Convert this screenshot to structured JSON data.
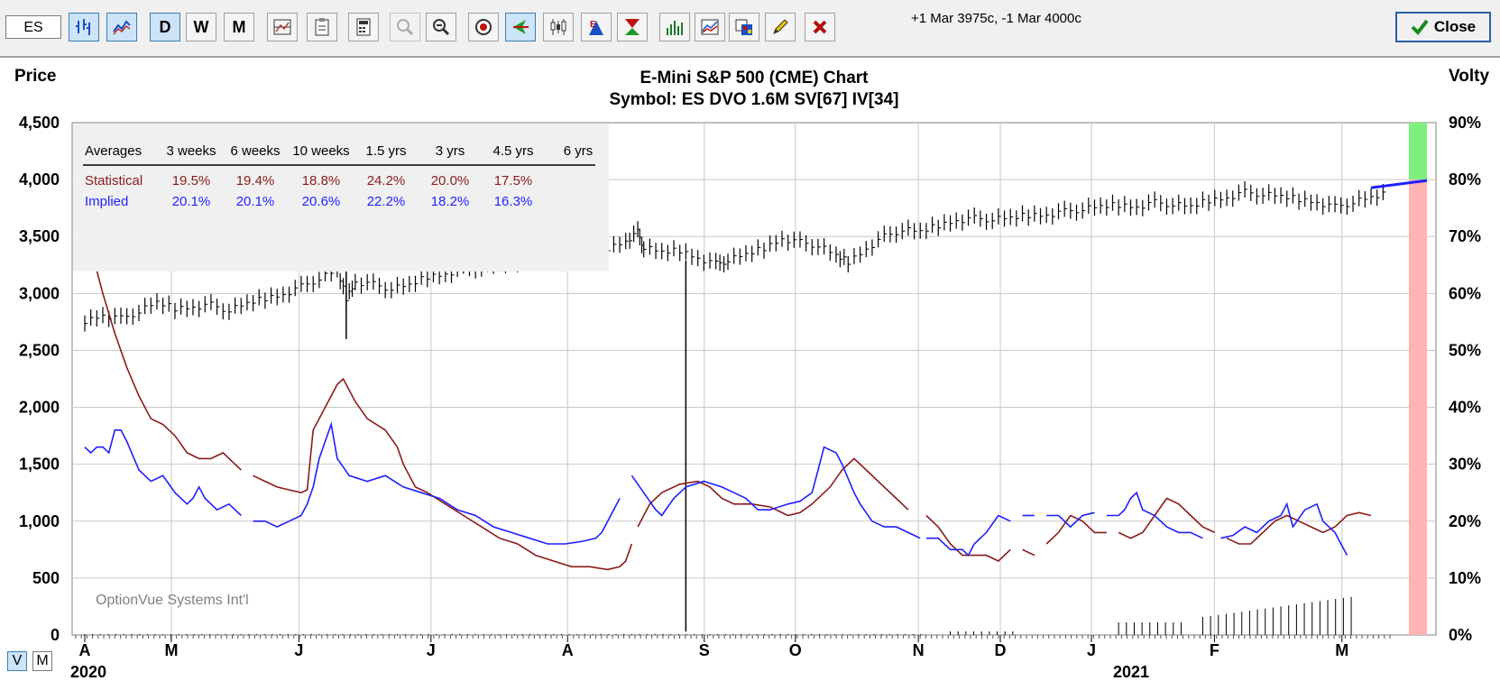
{
  "toolbar": {
    "symbol_value": "ES",
    "period_buttons": [
      "D",
      "W",
      "M"
    ],
    "strategy_text": "+1 Mar 3975c, -1 Mar 4000c",
    "close_label": "Close"
  },
  "view_toggle": [
    "V",
    "M"
  ],
  "colors": {
    "statistical": "#8b1a1a",
    "implied": "#1f1fff",
    "price_bars": "#000000",
    "gauge_upper": "#7ef07e",
    "gauge_lower": "#ffb3b3"
  },
  "chart_data": {
    "type": "line",
    "title": "E-Mini S&P 500 (CME) Chart",
    "subtitle": "Symbol: ES  DVO 1.6M  SV[67]  IV[34]",
    "ylabel": "Price",
    "y2label": "Volty",
    "watermark": "OptionVue Systems Int'l",
    "ylim": [
      0,
      4500
    ],
    "y2lim": [
      0,
      90
    ],
    "y_ticks": [
      "4,500",
      "4,000",
      "3,500",
      "3,000",
      "2,500",
      "2,000",
      "1,500",
      "1,000",
      "500",
      "0"
    ],
    "y2_ticks": [
      "90%",
      "80%",
      "70%",
      "60%",
      "50%",
      "40%",
      "30%",
      "20%",
      "10%",
      "0%"
    ],
    "x_months": [
      "A",
      "M",
      "J",
      "J",
      "A",
      "S",
      "O",
      "N",
      "D",
      "J",
      "F",
      "M"
    ],
    "x_years": [
      "2020",
      "2021"
    ],
    "table": {
      "headers": [
        "Averages",
        "3 weeks",
        "6 weeks",
        "10 weeks",
        "1.5 yrs",
        "3 yrs",
        "4.5 yrs",
        "6 yrs"
      ],
      "rows": [
        {
          "label": "Statistical",
          "values": [
            "19.5%",
            "19.4%",
            "18.8%",
            "24.2%",
            "20.0%",
            "17.5%",
            ""
          ]
        },
        {
          "label": "Implied",
          "values": [
            "20.1%",
            "20.1%",
            "20.6%",
            "22.2%",
            "18.2%",
            "16.3%",
            ""
          ]
        }
      ]
    },
    "price_points": [
      [
        0,
        2760
      ],
      [
        3,
        2810
      ],
      [
        6,
        2780
      ],
      [
        9,
        2840
      ],
      [
        12,
        2920
      ],
      [
        15,
        2870
      ],
      [
        18,
        2880
      ],
      [
        21,
        2900
      ],
      [
        24,
        2850
      ],
      [
        27,
        2910
      ],
      [
        30,
        2960
      ],
      [
        33,
        2990
      ],
      [
        36,
        3060
      ],
      [
        39,
        3130
      ],
      [
        42,
        3200
      ],
      [
        43.5,
        2960
      ],
      [
        45,
        3100
      ],
      [
        48,
        3080
      ],
      [
        51,
        3040
      ],
      [
        54,
        3070
      ],
      [
        57,
        3150
      ],
      [
        60,
        3170
      ],
      [
        63,
        3220
      ],
      [
        66,
        3230
      ],
      [
        69,
        3250
      ],
      [
        72,
        3280
      ],
      [
        75,
        3310
      ],
      [
        78,
        3340
      ],
      [
        81,
        3360
      ],
      [
        84,
        3380
      ],
      [
        87,
        3400
      ],
      [
        90,
        3460
      ],
      [
        92,
        3540
      ],
      [
        93,
        3400
      ],
      [
        96,
        3360
      ],
      [
        99,
        3380
      ],
      [
        102,
        3310
      ],
      [
        105,
        3260
      ],
      [
        107,
        3290
      ],
      [
        110,
        3340
      ],
      [
        113,
        3400
      ],
      [
        116,
        3480
      ],
      [
        119,
        3450
      ],
      [
        122,
        3420
      ],
      [
        125,
        3330
      ],
      [
        127,
        3280
      ],
      [
        130,
        3390
      ],
      [
        133,
        3500
      ],
      [
        136,
        3560
      ],
      [
        139,
        3540
      ],
      [
        142,
        3600
      ],
      [
        145,
        3640
      ],
      [
        148,
        3660
      ],
      [
        151,
        3650
      ],
      [
        154,
        3660
      ],
      [
        157,
        3690
      ],
      [
        160,
        3690
      ],
      [
        163,
        3720
      ],
      [
        166,
        3740
      ],
      [
        169,
        3760
      ],
      [
        172,
        3780
      ],
      [
        175,
        3760
      ],
      [
        178,
        3800
      ],
      [
        181,
        3780
      ],
      [
        184,
        3760
      ],
      [
        187,
        3820
      ],
      [
        190,
        3840
      ],
      [
        193,
        3890
      ],
      [
        196,
        3870
      ],
      [
        199,
        3850
      ],
      [
        202,
        3830
      ],
      [
        205,
        3800
      ],
      [
        208,
        3760
      ],
      [
        211,
        3800
      ],
      [
        214,
        3840
      ],
      [
        217,
        3880
      ]
    ],
    "series": [
      {
        "name": "Statistical",
        "points": [
          [
            0,
            72
          ],
          [
            1,
            68
          ],
          [
            2,
            64
          ],
          [
            3,
            60
          ],
          [
            5,
            53
          ],
          [
            7,
            47
          ],
          [
            9,
            42
          ],
          [
            11,
            38
          ],
          [
            13,
            37
          ],
          [
            15,
            35
          ],
          [
            17,
            32
          ],
          [
            19,
            31
          ],
          [
            21,
            31
          ],
          [
            23,
            32
          ],
          [
            25,
            30
          ],
          [
            26,
            29
          ],
          null,
          [
            28,
            28
          ],
          [
            30,
            27
          ],
          [
            32,
            26
          ],
          [
            34,
            25.5
          ],
          [
            36,
            25
          ],
          [
            37,
            25.5
          ],
          [
            38,
            36
          ],
          [
            40,
            40
          ],
          [
            42,
            44
          ],
          [
            43,
            45
          ],
          [
            45,
            41
          ],
          [
            47,
            38
          ],
          [
            50,
            36
          ],
          [
            52,
            33
          ],
          [
            53,
            30
          ],
          [
            54,
            28
          ],
          [
            55,
            26
          ],
          [
            57,
            25
          ],
          [
            60,
            23
          ],
          [
            63,
            21
          ],
          [
            66,
            19
          ],
          [
            69,
            17
          ],
          [
            72,
            16
          ],
          [
            75,
            14
          ],
          [
            78,
            13
          ],
          [
            81,
            12
          ],
          [
            84,
            12
          ],
          [
            87,
            11.5
          ],
          [
            89,
            12
          ],
          [
            90,
            13
          ],
          [
            91,
            16
          ],
          null,
          [
            92,
            19
          ],
          [
            94,
            23
          ],
          [
            96,
            25
          ],
          [
            99,
            26.5
          ],
          [
            102,
            27
          ],
          [
            104,
            26
          ],
          [
            106,
            24
          ],
          [
            108,
            23
          ],
          [
            111,
            23
          ],
          [
            114,
            22.5
          ],
          [
            117,
            21
          ],
          [
            119,
            21.5
          ],
          [
            121,
            23
          ],
          [
            124,
            26
          ],
          [
            126,
            29
          ],
          [
            128,
            31
          ],
          [
            130,
            29
          ],
          [
            133,
            26
          ],
          [
            135,
            24
          ],
          [
            137,
            22
          ],
          null,
          [
            140,
            21
          ],
          [
            142,
            19
          ],
          [
            144,
            16
          ],
          [
            146,
            14
          ],
          [
            148,
            14
          ],
          [
            150,
            14
          ],
          [
            152,
            13
          ],
          [
            154,
            15
          ],
          null,
          [
            156,
            15
          ],
          [
            158,
            14
          ],
          null,
          [
            160,
            16
          ],
          [
            162,
            18
          ],
          [
            164,
            21
          ],
          [
            166,
            20
          ],
          [
            168,
            18
          ],
          [
            170,
            18
          ],
          null,
          [
            172,
            18
          ],
          [
            174,
            17
          ],
          [
            176,
            18
          ],
          [
            178,
            21
          ],
          [
            180,
            24
          ],
          [
            182,
            23
          ],
          [
            184,
            21
          ],
          [
            186,
            19
          ],
          [
            188,
            18
          ],
          null,
          [
            190,
            17
          ],
          [
            192,
            16
          ],
          [
            194,
            16
          ],
          [
            196,
            18
          ],
          [
            198,
            20
          ],
          [
            200,
            21
          ],
          [
            202,
            20
          ],
          [
            204,
            19
          ],
          [
            206,
            18
          ],
          [
            208,
            19
          ],
          [
            210,
            21
          ],
          [
            212,
            21.5
          ],
          [
            214,
            21
          ]
        ]
      },
      {
        "name": "Implied",
        "points": [
          [
            0,
            33
          ],
          [
            1,
            32
          ],
          [
            2,
            33
          ],
          [
            3,
            33
          ],
          [
            4,
            32
          ],
          [
            5,
            36
          ],
          [
            6,
            36
          ],
          [
            7,
            34
          ],
          [
            9,
            29
          ],
          [
            11,
            27
          ],
          [
            13,
            28
          ],
          [
            15,
            25
          ],
          [
            17,
            23
          ],
          [
            18,
            24
          ],
          [
            19,
            26
          ],
          [
            20,
            24
          ],
          [
            22,
            22
          ],
          [
            24,
            23
          ],
          [
            26,
            21
          ],
          null,
          [
            28,
            20
          ],
          [
            30,
            20
          ],
          [
            32,
            19
          ],
          [
            34,
            20
          ],
          [
            36,
            21
          ],
          [
            37,
            23
          ],
          [
            38,
            26
          ],
          [
            39,
            31
          ],
          [
            40,
            34
          ],
          [
            41,
            37
          ],
          [
            42,
            31
          ],
          [
            44,
            28
          ],
          [
            47,
            27
          ],
          [
            50,
            28
          ],
          [
            53,
            26
          ],
          [
            56,
            25
          ],
          [
            59,
            24
          ],
          [
            62,
            22
          ],
          [
            65,
            21
          ],
          [
            68,
            19
          ],
          [
            71,
            18
          ],
          [
            74,
            17
          ],
          [
            77,
            16
          ],
          [
            80,
            16
          ],
          [
            83,
            16.5
          ],
          [
            85,
            17
          ],
          [
            86,
            18
          ],
          [
            88,
            22
          ],
          [
            89,
            24
          ],
          null,
          [
            91,
            28
          ],
          [
            93,
            25
          ],
          [
            95,
            22
          ],
          [
            96,
            21
          ],
          [
            98,
            24
          ],
          [
            100,
            26
          ],
          [
            103,
            27
          ],
          [
            106,
            26
          ],
          [
            108,
            25
          ],
          [
            110,
            24
          ],
          [
            112,
            22
          ],
          [
            114,
            22
          ],
          [
            117,
            23
          ],
          [
            119,
            23.5
          ],
          [
            121,
            25
          ],
          [
            122,
            29
          ],
          [
            123,
            33
          ],
          [
            125,
            32
          ],
          [
            126,
            30
          ],
          [
            128,
            25
          ],
          [
            129,
            23
          ],
          [
            131,
            20
          ],
          [
            133,
            19
          ],
          [
            135,
            19
          ],
          [
            137,
            18
          ],
          [
            139,
            17
          ],
          null,
          [
            140,
            17
          ],
          [
            142,
            17
          ],
          [
            144,
            15
          ],
          [
            146,
            15
          ],
          [
            147,
            14
          ],
          [
            148,
            16
          ],
          [
            150,
            18
          ],
          [
            152,
            21
          ],
          [
            154,
            20
          ],
          null,
          [
            156,
            21
          ],
          [
            158,
            21
          ],
          null,
          [
            160,
            21
          ],
          [
            162,
            21
          ],
          [
            164,
            19
          ],
          [
            166,
            21
          ],
          [
            168,
            21.5
          ],
          null,
          [
            170,
            21
          ],
          [
            172,
            21
          ],
          [
            173,
            22
          ],
          [
            174,
            24
          ],
          [
            175,
            25
          ],
          [
            176,
            22
          ],
          [
            178,
            21
          ],
          [
            180,
            19
          ],
          [
            182,
            18
          ],
          [
            184,
            18
          ],
          [
            186,
            17
          ],
          null,
          [
            189,
            17
          ],
          [
            191,
            17.5
          ],
          [
            193,
            19
          ],
          [
            195,
            18
          ],
          [
            197,
            20
          ],
          [
            199,
            21
          ],
          [
            200,
            23
          ],
          [
            201,
            19
          ],
          [
            203,
            22
          ],
          [
            205,
            23
          ],
          [
            206,
            20
          ],
          [
            208,
            18
          ],
          [
            209,
            16
          ],
          [
            210,
            14
          ]
        ]
      }
    ],
    "current_marker": {
      "price": 3960,
      "volty_low": 80,
      "volty_high": 90
    },
    "spike": {
      "x": 100,
      "low": 30,
      "high": 3290
    },
    "spike_june": {
      "x": 43.5,
      "low": 2600,
      "high": 3230
    }
  }
}
